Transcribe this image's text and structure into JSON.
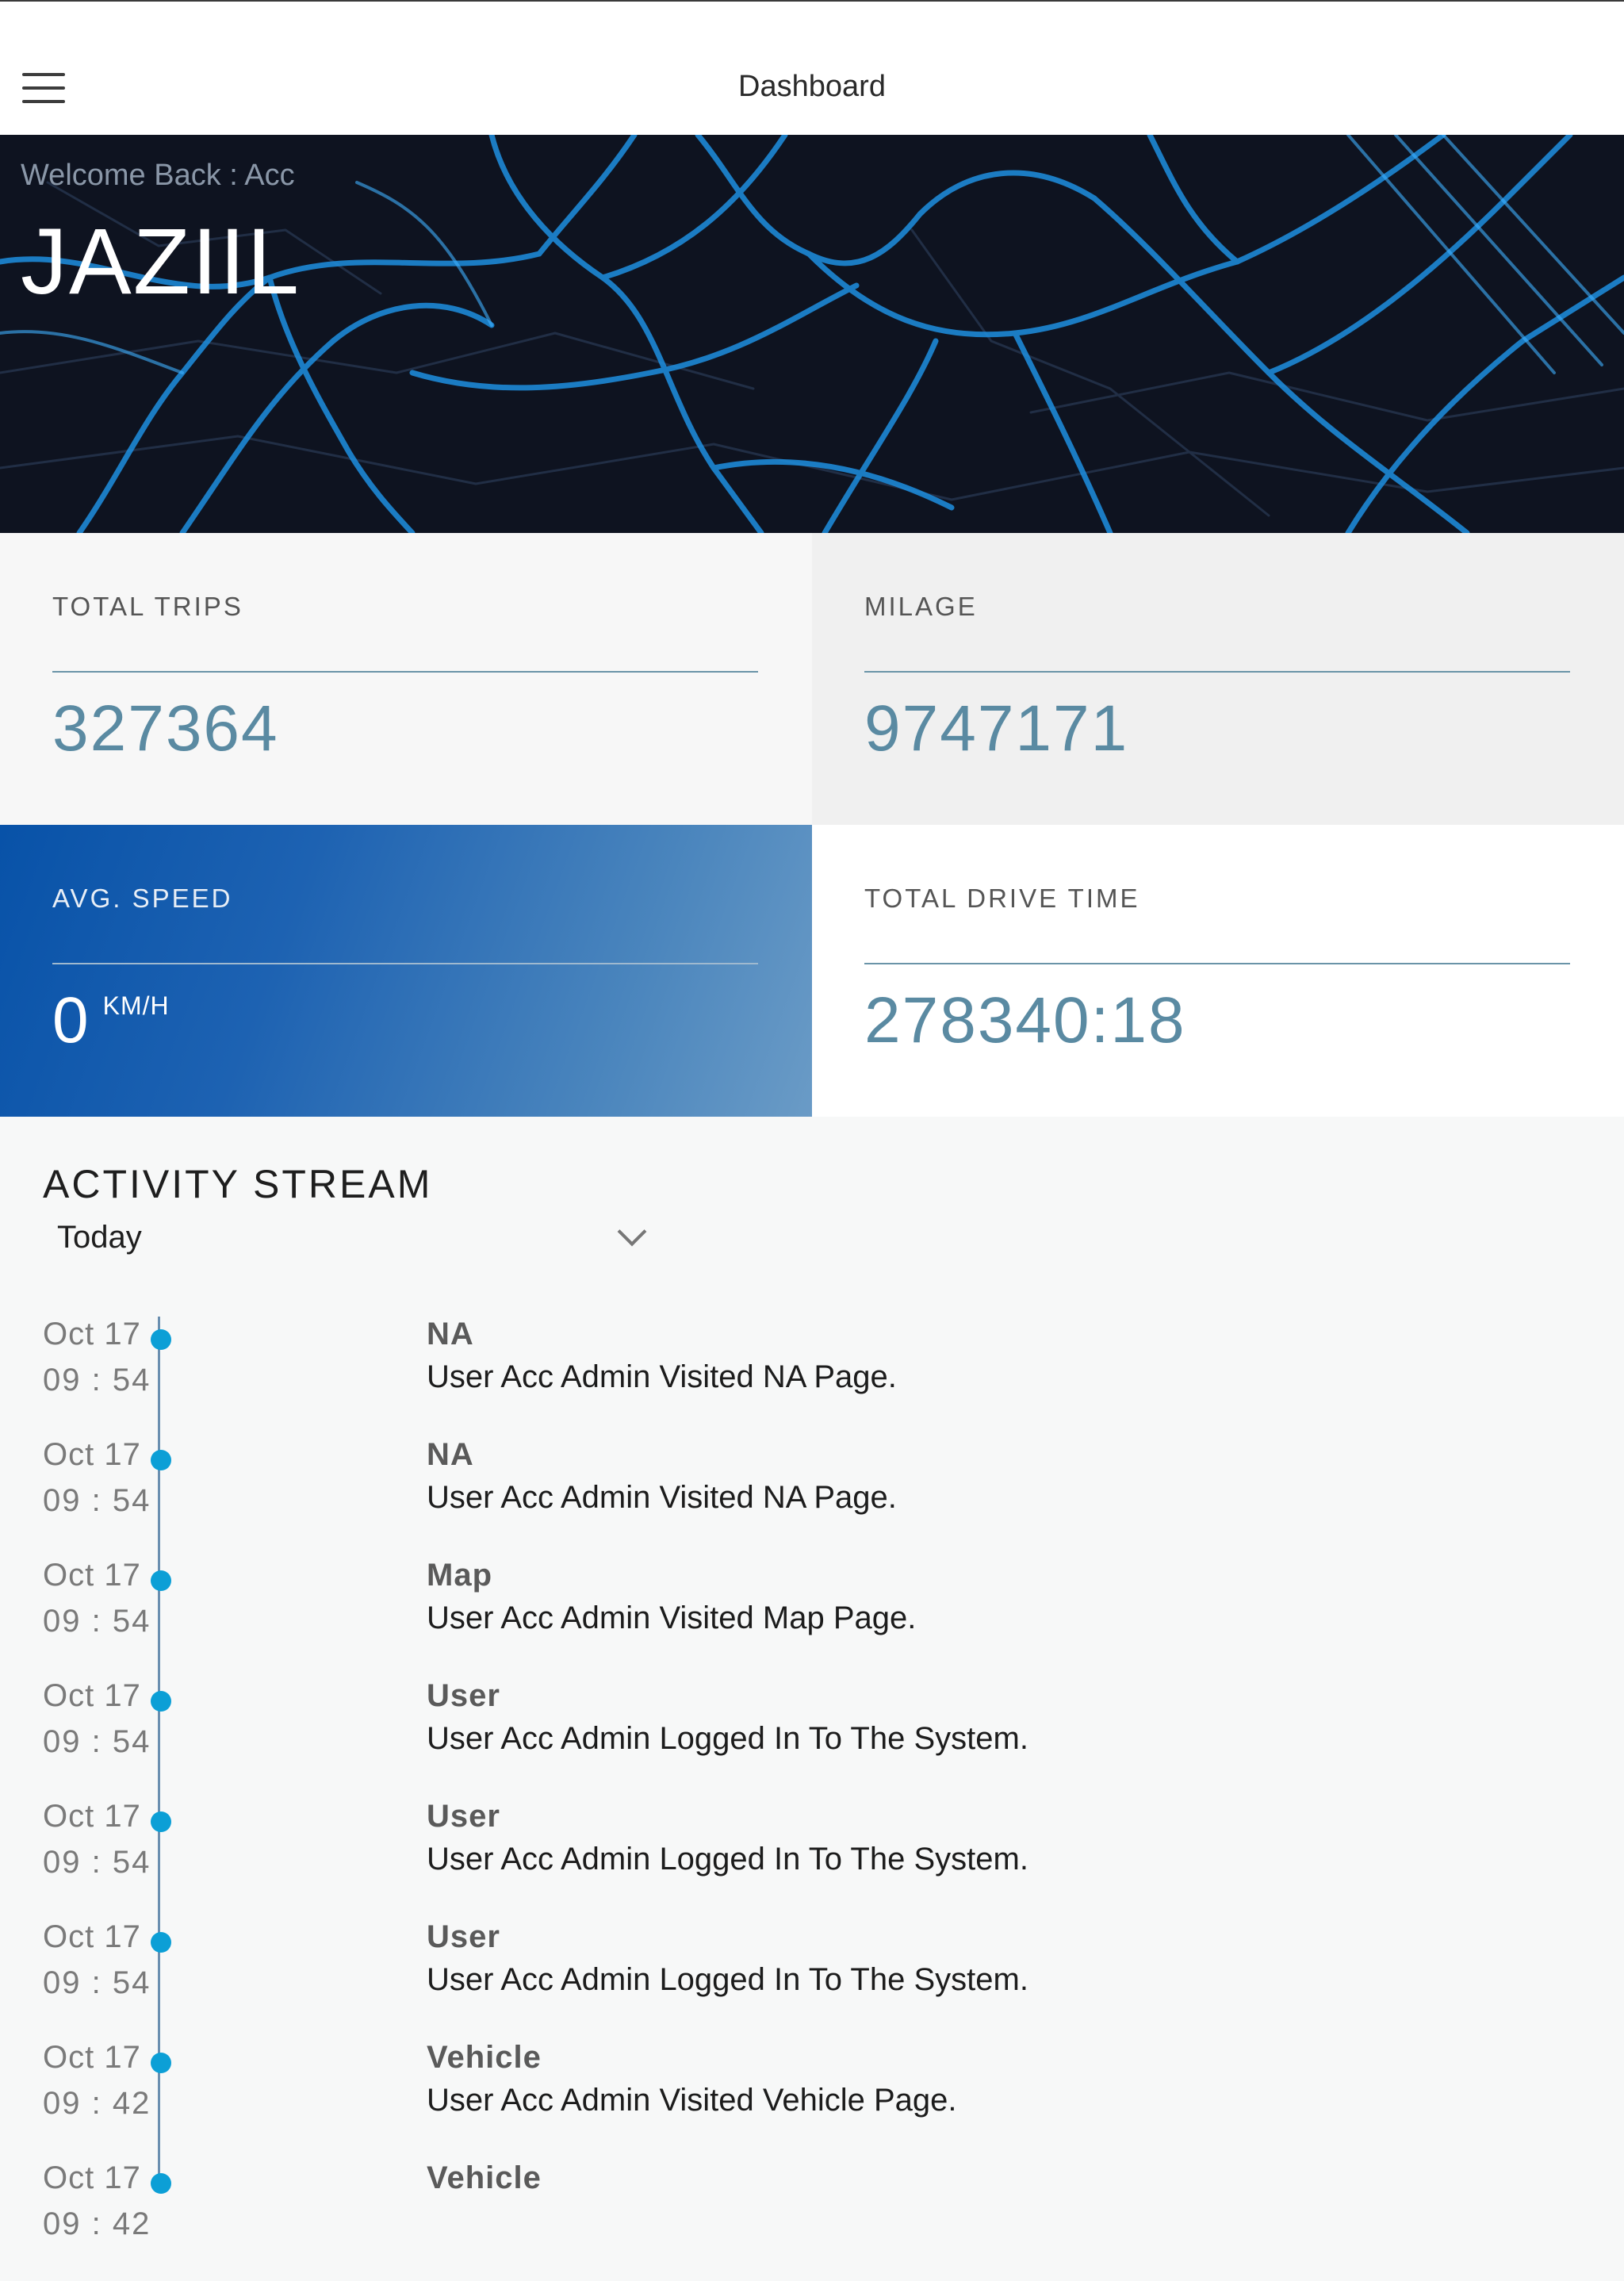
{
  "header": {
    "title": "Dashboard",
    "menu_icon": "hamburger-menu-icon"
  },
  "hero": {
    "welcome": "Welcome Back : Acc",
    "username": "JAZIIL",
    "background": "city-map-streets"
  },
  "stats": {
    "total_trips": {
      "label": "TOTAL TRIPS",
      "value": "327364"
    },
    "mileage": {
      "label": "MILAGE",
      "value": "9747171"
    },
    "avg_speed": {
      "label": "AVG. SPEED",
      "value": "0",
      "unit": "KM/H"
    },
    "drive_time": {
      "label": "TOTAL DRIVE TIME",
      "value": "278340:18"
    }
  },
  "activity": {
    "title": "ACTIVITY STREAM",
    "range": "Today",
    "events": [
      {
        "date": "Oct 17",
        "time": "09 : 54",
        "category": "NA",
        "description": "User Acc Admin Visited NA Page."
      },
      {
        "date": "Oct 17",
        "time": "09 : 54",
        "category": "NA",
        "description": "User Acc Admin Visited NA Page."
      },
      {
        "date": "Oct 17",
        "time": "09 : 54",
        "category": "Map",
        "description": "User Acc Admin Visited Map Page."
      },
      {
        "date": "Oct 17",
        "time": "09 : 54",
        "category": "User",
        "description": "User Acc Admin Logged In To The System."
      },
      {
        "date": "Oct 17",
        "time": "09 : 54",
        "category": "User",
        "description": "User Acc Admin Logged In To The System."
      },
      {
        "date": "Oct 17",
        "time": "09 : 54",
        "category": "User",
        "description": "User Acc Admin Logged In To The System."
      },
      {
        "date": "Oct 17",
        "time": "09 : 42",
        "category": "Vehicle",
        "description": "User Acc Admin Visited Vehicle Page."
      },
      {
        "date": "Oct 17",
        "time": "09 : 42",
        "category": "Vehicle",
        "description": ""
      }
    ]
  },
  "colors": {
    "accent": "#5a8aa2",
    "timeline_dot": "#0c9fd6",
    "speed_card": "#0852a8",
    "hero_bg": "#0e1320",
    "map_lines": "#1e8fe0"
  }
}
